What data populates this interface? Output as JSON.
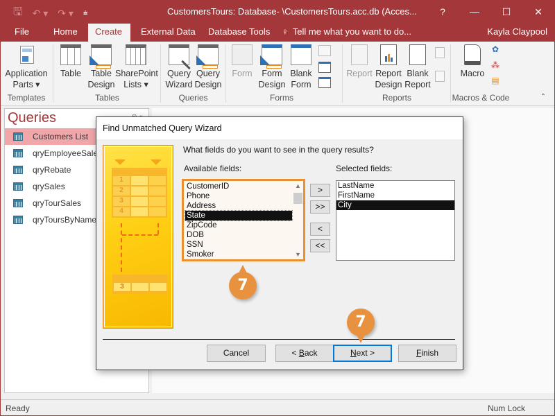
{
  "window": {
    "title": "CustomersTours: Database- \\CustomersTours.acc.db (Acces...",
    "help": "?",
    "minimize": "—",
    "maximize": "☐",
    "close": "✕"
  },
  "qat": {
    "save": "🖫",
    "undo": "↶ ▾",
    "redo": "↷ ▾",
    "customize": "⩧"
  },
  "tabs": [
    {
      "label": "File"
    },
    {
      "label": "Home"
    },
    {
      "label": "Create"
    },
    {
      "label": "External Data"
    },
    {
      "label": "Database Tools"
    }
  ],
  "tell_me": "Tell me what you want to do...",
  "user": "Kayla Claypool",
  "ribbon": {
    "groups": {
      "templates": "Templates",
      "tables": "Tables",
      "queries": "Queries",
      "forms": "Forms",
      "reports": "Reports",
      "macros": "Macros & Code"
    },
    "buttons": {
      "app_parts": [
        "Application",
        "Parts ▾"
      ],
      "table": [
        "Table"
      ],
      "table_design": [
        "Table",
        "Design"
      ],
      "sharepoint": [
        "SharePoint",
        "Lists ▾"
      ],
      "query_wizard": [
        "Query",
        "Wizard"
      ],
      "query_design": [
        "Query",
        "Design"
      ],
      "form": [
        "Form"
      ],
      "form_design": [
        "Form",
        "Design"
      ],
      "blank_form": [
        "Blank",
        "Form"
      ],
      "report": [
        "Report"
      ],
      "report_design": [
        "Report",
        "Design"
      ],
      "blank_report": [
        "Blank",
        "Report"
      ],
      "macro": [
        "Macro"
      ]
    },
    "collapse": "⌃"
  },
  "nav": {
    "title": "Queries",
    "items": [
      {
        "label": "Customers List",
        "selected": true
      },
      {
        "label": "qryEmployeeSales"
      },
      {
        "label": "qryRebate"
      },
      {
        "label": "qrySales"
      },
      {
        "label": "qryTourSales"
      },
      {
        "label": "qryToursByName"
      }
    ]
  },
  "dialog": {
    "title": "Find Unmatched Query Wizard",
    "prompt": "What fields do you want to see in the query results?",
    "available_label": "Available fields:",
    "selected_label": "Selected fields:",
    "available": [
      "CustomerID",
      "Phone",
      "Address",
      "State",
      "ZipCode",
      "DOB",
      "SSN",
      "Smoker"
    ],
    "available_selected": "State",
    "selected": [
      "LastName",
      "FirstName",
      "City"
    ],
    "selected_selected": "City",
    "move_one": ">",
    "move_all": ">>",
    "remove_one": "<",
    "remove_all": "<<",
    "cancel": "Cancel",
    "back_prefix": "< ",
    "back_u": "B",
    "back_rest": "ack",
    "next_u": "N",
    "next_rest": "ext >",
    "finish_u": "F",
    "finish_rest": "inish",
    "wizard_image": {
      "rows": [
        "1",
        "2",
        "3",
        "4"
      ],
      "result_row": "3"
    }
  },
  "callouts": {
    "step_a": "7",
    "step_b": "7"
  },
  "status": {
    "left": "Ready",
    "right": "Num Lock"
  },
  "colors": {
    "accent": "#a4373a",
    "callout": "#e8913e",
    "focus": "#0078d7"
  }
}
